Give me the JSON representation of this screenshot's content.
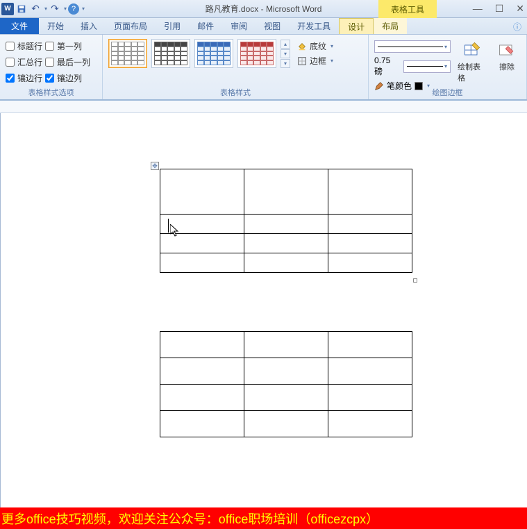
{
  "titlebar": {
    "doc_name": "路凡教育.docx",
    "app_name": "Microsoft Word",
    "separator": " - ",
    "context_label": "表格工具"
  },
  "window_controls": {
    "min": "—",
    "restore": "☐",
    "close": "✕"
  },
  "tabs": {
    "file": "文件",
    "home": "开始",
    "insert": "插入",
    "page_layout": "页面布局",
    "references": "引用",
    "mailings": "邮件",
    "review": "审阅",
    "view": "视图",
    "developer": "开发工具",
    "design": "设计",
    "layout": "布局"
  },
  "style_options": {
    "header_row": "标题行",
    "first_column": "第一列",
    "total_row": "汇总行",
    "last_column": "最后一列",
    "banded_rows": "镶边行",
    "banded_columns": "镶边列",
    "checked": {
      "header_row": false,
      "first_column": false,
      "total_row": false,
      "last_column": false,
      "banded_rows": true,
      "banded_columns": true
    },
    "group_label": "表格样式选项"
  },
  "table_styles": {
    "shading": "底纹",
    "borders": "边框",
    "group_label": "表格样式"
  },
  "draw_borders": {
    "width_value": "0.75 磅",
    "pen_color": "笔颜色",
    "draw_table": "绘制表格",
    "eraser": "擦除",
    "group_label": "绘图边框"
  },
  "footer": "更多office技巧视频，欢迎关注公众号：office职场培训（officezcpx）"
}
